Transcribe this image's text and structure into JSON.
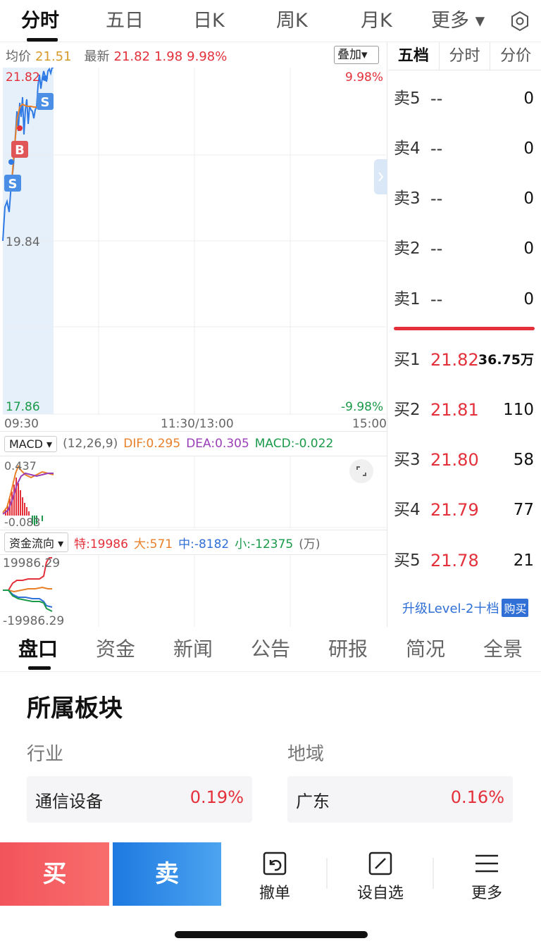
{
  "top_tabs": [
    "分时",
    "五日",
    "日K",
    "周K",
    "月K",
    "更多 ▾"
  ],
  "legend": {
    "avg_label": "均价",
    "avg_value": "21.51",
    "latest_label": "最新",
    "latest_value": "21.82",
    "change": "1.98",
    "change_pct": "9.98%",
    "overlay_label": "叠加▾"
  },
  "price_axis": {
    "top_left": "21.82",
    "top_right": "9.98%",
    "mid_left": "19.84",
    "bottom_left": "17.86",
    "bottom_right": "-9.98%"
  },
  "time_axis": [
    "09:30",
    "11:30/13:00",
    "15:00"
  ],
  "markers": {
    "sell": "S",
    "buy": "B"
  },
  "macd": {
    "selector": "MACD ▾",
    "params": "(12,26,9)",
    "dif": "DIF:0.295",
    "dea": "DEA:0.305",
    "macd": "MACD:-0.022",
    "top_value": "0.437",
    "bottom_value": "-0.083"
  },
  "fund_flow": {
    "selector": "资金流向 ▾",
    "te": "特:19986",
    "da": "大:571",
    "zhong": "中:-8182",
    "xiao": "小:-12375",
    "unit": "(万)",
    "top_value": "19986.29",
    "bottom_value": "-19986.29"
  },
  "orderbook": {
    "tabs": [
      "五档",
      "分时",
      "分价"
    ],
    "asks": [
      {
        "label": "卖5",
        "price": "--",
        "volume": "0"
      },
      {
        "label": "卖4",
        "price": "--",
        "volume": "0"
      },
      {
        "label": "卖3",
        "price": "--",
        "volume": "0"
      },
      {
        "label": "卖2",
        "price": "--",
        "volume": "0"
      },
      {
        "label": "卖1",
        "price": "--",
        "volume": "0"
      }
    ],
    "bids": [
      {
        "label": "买1",
        "price": "21.82",
        "volume": "36.75万"
      },
      {
        "label": "买2",
        "price": "21.81",
        "volume": "110"
      },
      {
        "label": "买3",
        "price": "21.80",
        "volume": "58"
      },
      {
        "label": "买4",
        "price": "21.79",
        "volume": "77"
      },
      {
        "label": "买5",
        "price": "21.78",
        "volume": "21"
      }
    ],
    "upgrade_text": "升级Level-2十档",
    "buy_badge": "购买"
  },
  "section_tabs": [
    "盘口",
    "资金",
    "新闻",
    "公告",
    "研报",
    "简况",
    "全景"
  ],
  "sector": {
    "title": "所属板块",
    "industry_label": "行业",
    "region_label": "地域",
    "industry_name": "通信设备",
    "industry_change": "0.19%",
    "region_name": "广东",
    "region_change": "0.16%"
  },
  "bottom_bar": {
    "buy": "买",
    "sell": "卖",
    "cancel": "撤单",
    "watchlist": "设自选",
    "more": "更多"
  },
  "colors": {
    "up": "#e3303a",
    "down": "#1a9a4a",
    "accent_blue": "#2f6fd6"
  }
}
